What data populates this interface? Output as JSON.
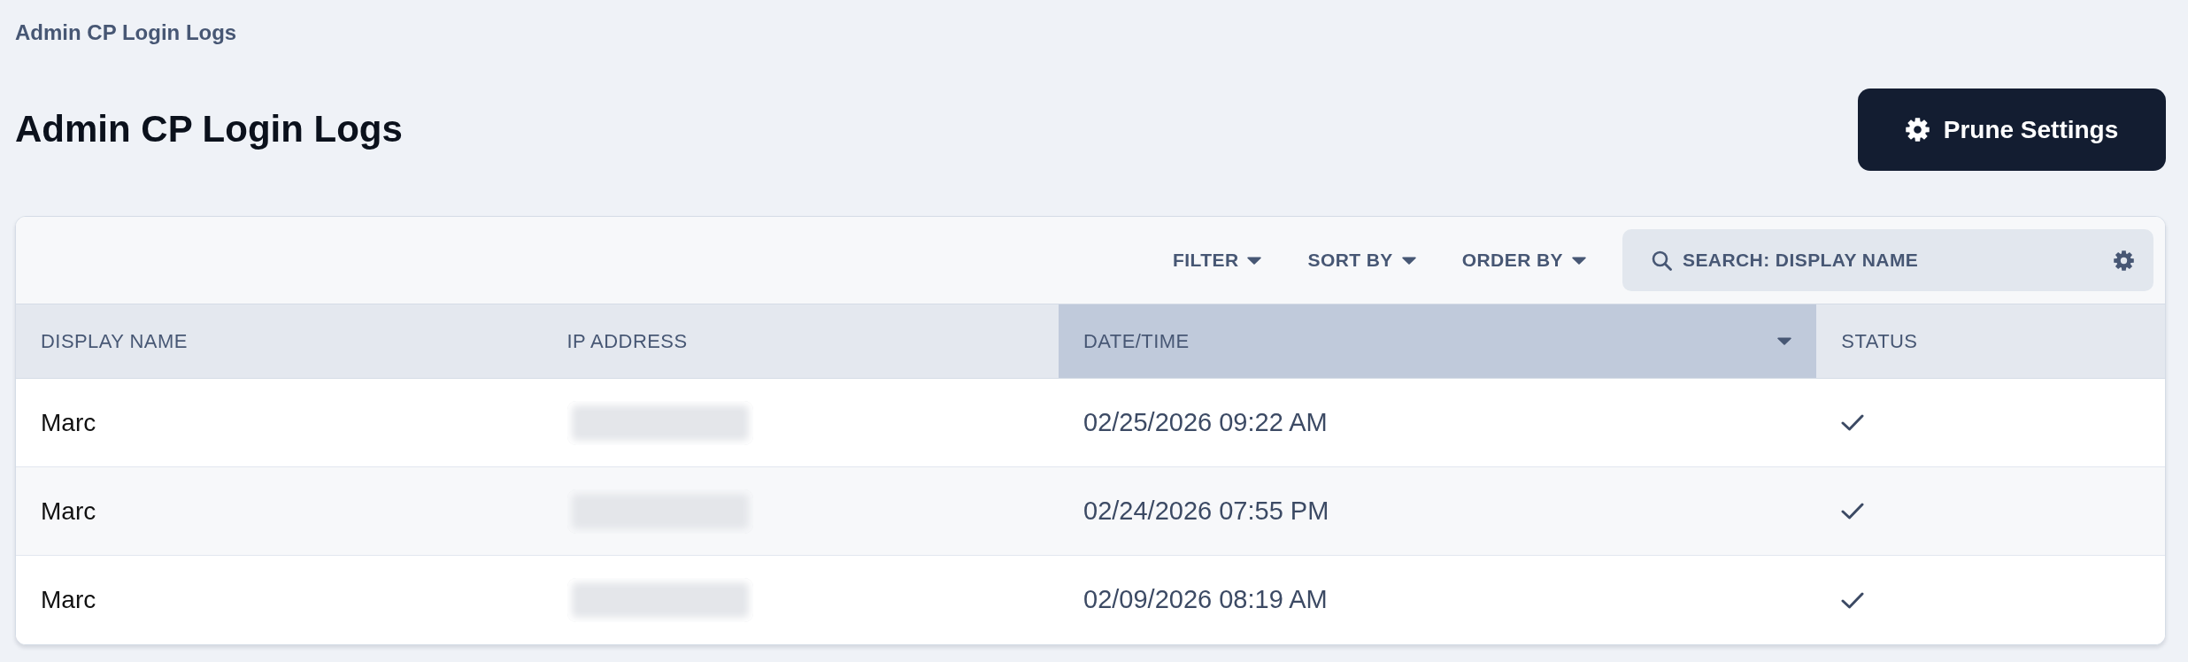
{
  "breadcrumb": "Admin CP Login Logs",
  "page_title": "Admin CP Login Logs",
  "prune_button": {
    "label": "Prune Settings"
  },
  "toolbar": {
    "dropdowns": [
      {
        "label": "FILTER"
      },
      {
        "label": "SORT BY"
      },
      {
        "label": "ORDER BY"
      }
    ],
    "search": {
      "placeholder": "SEARCH: DISPLAY NAME"
    }
  },
  "table": {
    "columns": [
      {
        "label": "DISPLAY NAME",
        "sorted": false
      },
      {
        "label": "IP ADDRESS",
        "sorted": false
      },
      {
        "label": "DATE/TIME",
        "sorted": true
      },
      {
        "label": "STATUS",
        "sorted": false
      }
    ],
    "rows": [
      {
        "display_name": "Marc",
        "ip_blurred": true,
        "date_time": "02/25/2026 09:22 AM",
        "success": true
      },
      {
        "display_name": "Marc",
        "ip_blurred": true,
        "date_time": "02/24/2026 07:55 PM",
        "success": true
      },
      {
        "display_name": "Marc",
        "ip_blurred": true,
        "date_time": "02/09/2026 08:19 AM",
        "success": true
      }
    ]
  }
}
